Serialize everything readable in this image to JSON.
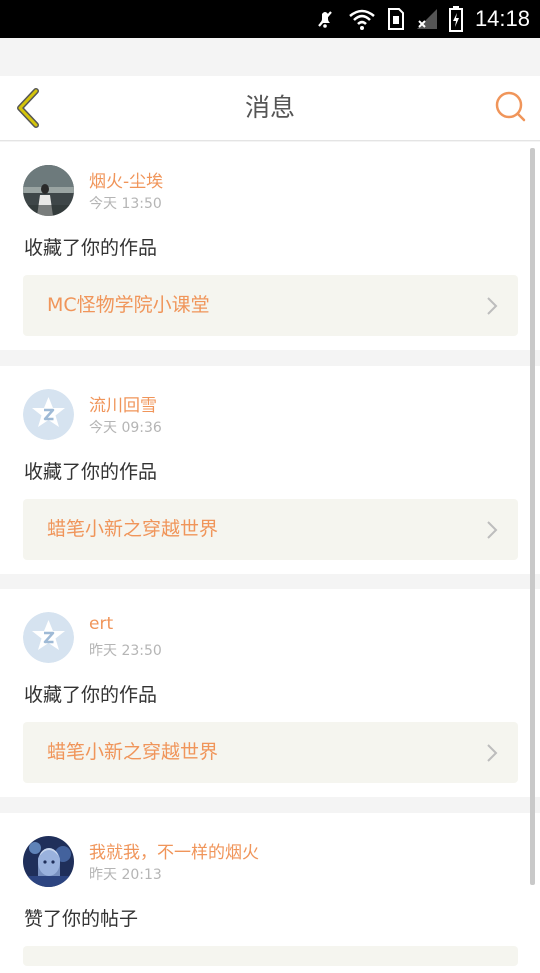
{
  "status_bar": {
    "time": "14:18",
    "icons": [
      "mute-icon",
      "wifi-icon",
      "sim-icon",
      "signal-icon",
      "battery-icon"
    ]
  },
  "header": {
    "title": "消息",
    "back_icon": "chevron-left-icon",
    "search_icon": "search-icon"
  },
  "colors": {
    "accent": "#f0955a",
    "back_arrow": "#d4c40a",
    "background": "#f4f4f4"
  },
  "messages": [
    {
      "username": "烟火-尘埃",
      "time": "今天 13:50",
      "action": "收藏了你的作品",
      "work_title": "MC怪物学院小课堂",
      "avatar": "photo-avatar"
    },
    {
      "username": "流川回雪",
      "time": "今天 09:36",
      "action": "收藏了你的作品",
      "work_title": "蜡笔小新之穿越世界",
      "avatar": "qq-avatar"
    },
    {
      "username": "ert",
      "time": "昨天 23:50",
      "action": "收藏了你的作品",
      "work_title": "蜡笔小新之穿越世界",
      "avatar": "qq-avatar"
    },
    {
      "username": "我就我，不一样的烟火",
      "time": "昨天 20:13",
      "action": "赞了你的帖子",
      "work_title": "",
      "avatar": "anime-avatar"
    }
  ]
}
